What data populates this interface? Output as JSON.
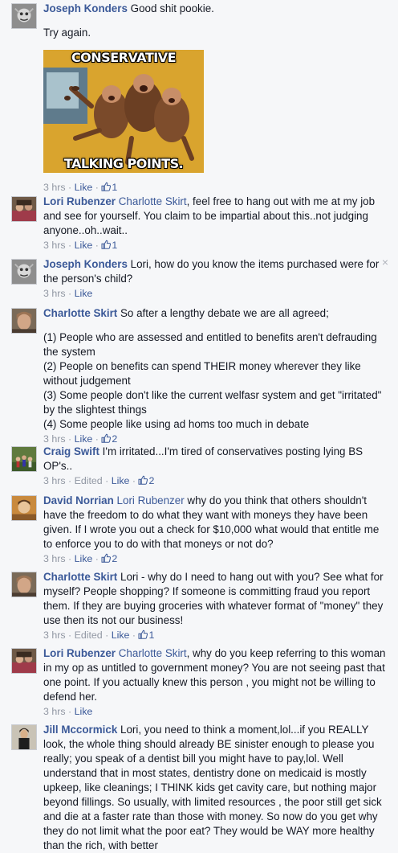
{
  "comments": [
    {
      "author": "Joseph Konders",
      "text": "Good shit pookie.",
      "text2": "Try again.",
      "image_caption_top": "CONSERVATIVE",
      "image_caption_bottom": "TALKING POINTS.",
      "time": "3 hrs",
      "like_label": "Like",
      "like_count": "1"
    },
    {
      "author": "Lori Rubenzer",
      "mention": "Charlotte Skirt",
      "text": ", feel free to hang out with me at my job and see for yourself. You claim to be impartial about this..not judging anyone..oh..wait..",
      "time": "3 hrs",
      "like_label": "Like",
      "like_count": "1"
    },
    {
      "author": "Joseph Konders",
      "text": "Lori, how do you know the items purchased were for the person's child?",
      "time": "3 hrs",
      "like_label": "Like",
      "close_glyph": "×"
    },
    {
      "author": "Charlotte Skirt",
      "text": "So after a lengthy debate we are all agreed;",
      "points": [
        "(1) People who are assessed and entitled to benefits aren't defrauding the system",
        "(2) People on benefits can spend THEIR money wherever they like without judgement",
        "(3) Some people don't like the current welfasr system and get \"irritated\" by the slightest things",
        "(4) Some people like using ad homs too much in debate"
      ],
      "time": "3 hrs",
      "like_label": "Like",
      "like_count": "2"
    },
    {
      "author": "Craig Swift",
      "text": "I'm irritated...I'm tired of conservatives posting lying BS OP's..",
      "time": "3 hrs",
      "edited": "Edited",
      "like_label": "Like",
      "like_count": "2"
    },
    {
      "author": "David Norrian",
      "mention": "Lori Rubenzer",
      "text": " why do you think that others shouldn't have the freedom to do what they want with moneys they have been given. If I wrote you out a check for $10,000 what would that entitle me to enforce you to do with that moneys or not do?",
      "time": "3 hrs",
      "like_label": "Like",
      "like_count": "2"
    },
    {
      "author": "Charlotte Skirt",
      "text": "Lori - why do I need to hang out with you? See what for myself? People shopping? If someone is committing fraud you report them. If they are buying groceries with whatever format of \"money\" they use then its not our business!",
      "time": "3 hrs",
      "edited": "Edited",
      "like_label": "Like",
      "like_count": "1"
    },
    {
      "author": "Lori Rubenzer",
      "mention": "Charlotte Skirt",
      "text": ", why do you keep referring to this woman in my op as untitled to government money? You are not seeing past that one point. If you actually knew this person , you might not be willing to defend her.",
      "time": "3 hrs",
      "like_label": "Like"
    },
    {
      "author": "Jill Mccormick",
      "text": "Lori, you need to think a moment,lol...if you REALLY look, the whole thing should already BE sinister enough to please you really; you speak of a dentist bill you might have to pay,lol. Well understand that in most states, dentistry done on medicaid is mostly upkeep, like cleanings; I THINK kids get cavity care, but nothing major beyond fillings. So usually, with limited resources , the poor still get sick and die at a faster rate than those with money. So now do you get why they do not limit what the poor eat? They would be WAY more healthy than the rich, with better"
    }
  ],
  "separator": " · ",
  "colors": {
    "link": "#3b5998",
    "meta": "#9197a3",
    "background": "#f6f7f9"
  }
}
